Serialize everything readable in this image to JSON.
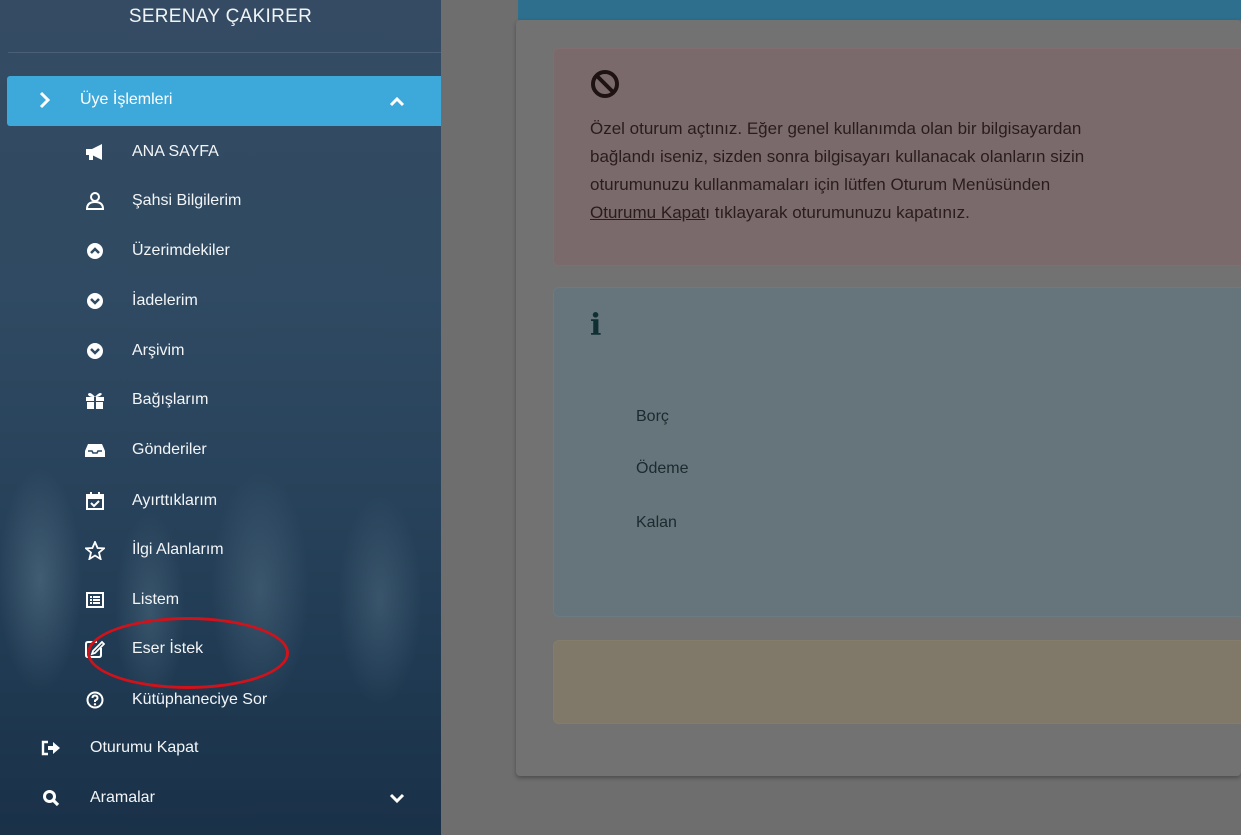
{
  "sidebar": {
    "user_name": "SERENAY ÇAKIRER",
    "section": {
      "label": "Üye İşlemleri"
    },
    "items": [
      {
        "label": "ANA SAYFA",
        "icon": "bullhorn-icon"
      },
      {
        "label": "Şahsi Bilgilerim",
        "icon": "user-icon"
      },
      {
        "label": "Üzerimdekiler",
        "icon": "chevron-circle-up-icon"
      },
      {
        "label": "İadelerim",
        "icon": "chevron-circle-down-icon"
      },
      {
        "label": "Arşivim",
        "icon": "chevron-circle-down-icon"
      },
      {
        "label": "Bağışlarım",
        "icon": "gift-icon"
      },
      {
        "label": "Gönderiler",
        "icon": "inbox-icon"
      },
      {
        "label": "Ayırttıklarım",
        "icon": "calendar-check-icon"
      },
      {
        "label": "İlgi Alanlarım",
        "icon": "star-icon"
      },
      {
        "label": "Listem",
        "icon": "list-icon"
      },
      {
        "label": "Eser İstek",
        "icon": "edit-icon"
      },
      {
        "label": "Kütüphaneciye Sor",
        "icon": "question-circle-icon"
      }
    ],
    "logout": {
      "label": "Oturumu Kapat",
      "icon": "sign-out-icon"
    },
    "search": {
      "label": "Aramalar",
      "icon": "search-icon"
    },
    "highlight_color": "#d0121b",
    "active_color": "#3da8da"
  },
  "alerts": {
    "danger": {
      "icon": "ban-icon",
      "line1": "Özel oturum açtınız. Eğer genel kullanımda olan bir bilgisayardan",
      "line2": "bağlandı iseniz, sizden sonra bilgisayarı kullanacak olanların sizin",
      "line3": "oturumunuzu kullanmamaları için lütfen Oturum Menüsünden",
      "link": "Oturumu Kapat",
      "line4_rest": "ı tıklayarak oturumunuzu kapatınız."
    },
    "info": {
      "icon": "info-icon",
      "rows": [
        "Borç",
        "Ödeme",
        "Kalan"
      ]
    }
  }
}
